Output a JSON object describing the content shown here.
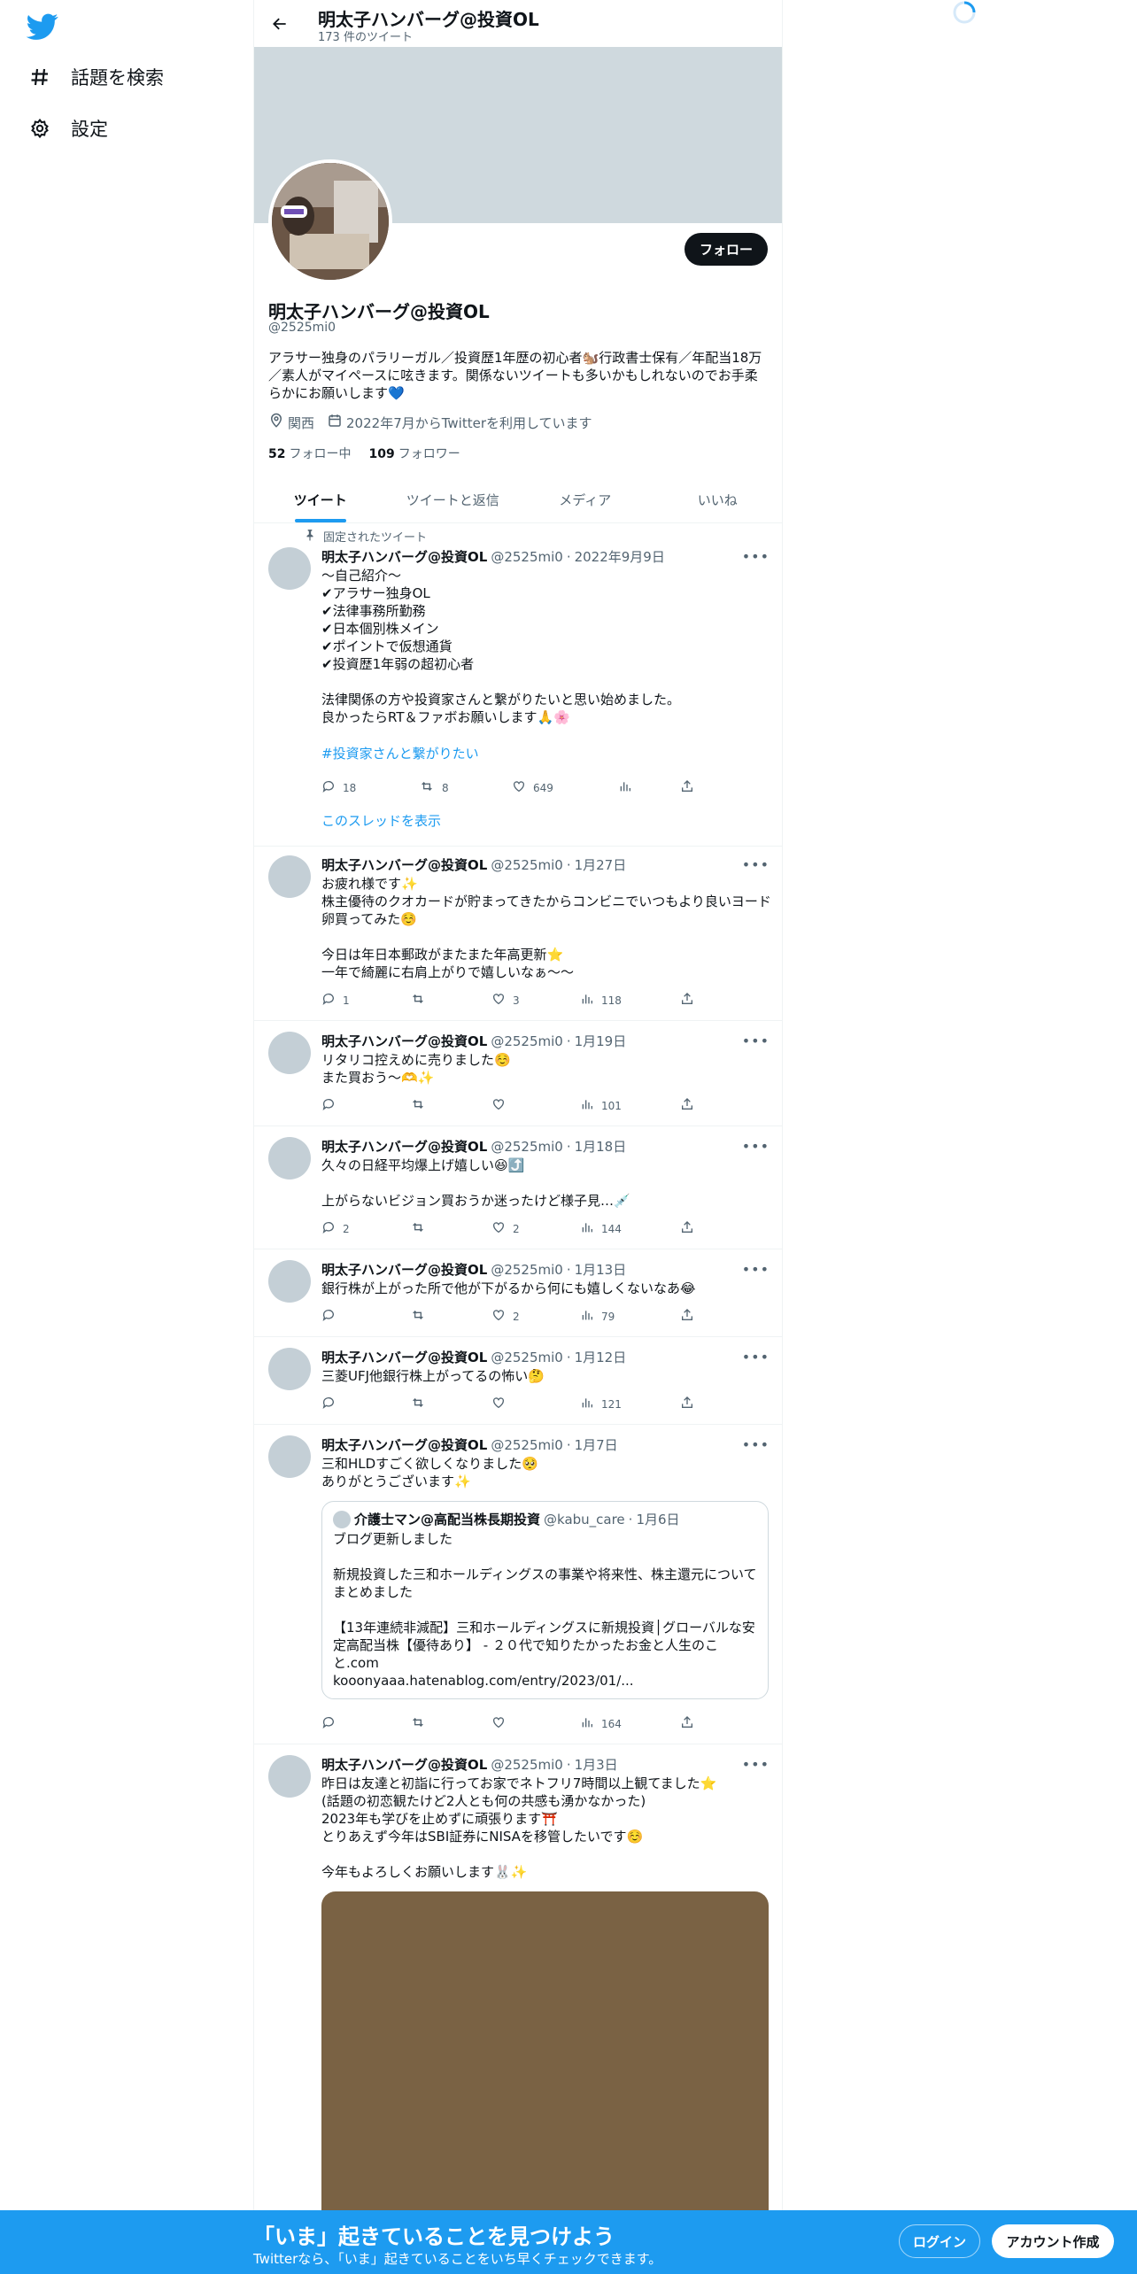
{
  "nav": {
    "items": [
      {
        "label": "話題を検索",
        "icon": "hashtag-icon"
      },
      {
        "label": "設定",
        "icon": "gear-icon"
      }
    ]
  },
  "header": {
    "title": "明太子ハンバーグ@投資OL",
    "subtitle": "173 件のツイート"
  },
  "profile": {
    "follow_label": "フォロー",
    "name": "明太子ハンバーグ@投資OL",
    "handle": "@2525mi0",
    "bio": "アラサー独身のパラリーガル／投資歴1年歴の初心者🐿️行政書士保有／年配当18万／素人がマイペースに呟きます。関係ないツイートも多いかもしれないのでお手柔らかにお願いします💙",
    "location": "関西",
    "joined": "2022年7月からTwitterを利用しています",
    "following_count": "52",
    "following_label": "フォロー中",
    "followers_count": "109",
    "followers_label": "フォロワー"
  },
  "tabs": [
    "ツイート",
    "ツイートと返信",
    "メディア",
    "いいね"
  ],
  "pinned_label": "固定されたツイート",
  "thread_link": "このスレッドを表示",
  "tweets": [
    {
      "name": "明太子ハンバーグ@投資OL",
      "handle": "@2525mi0",
      "date": "2022年9月9日",
      "text": "～自己紹介～\n✔アラサー独身OL\n✔法律事務所勤務\n✔日本個別株メイン\n✔ポイントで仮想通貨\n✔投資歴1年弱の超初心者\n\n法律関係の方や投資家さんと繋がりたいと思い始めました。\n良かったらRT＆ファボお願いします🙏🌸",
      "hashtag": "#投資家さんと繋がりたい",
      "replies": "18",
      "retweets": "8",
      "likes": "649",
      "views": ""
    },
    {
      "name": "明太子ハンバーグ@投資OL",
      "handle": "@2525mi0",
      "date": "1月27日",
      "text": "お疲れ様です✨\n株主優待のクオカードが貯まってきたからコンビニでいつもより良いヨード卵買ってみた☺️\n\n今日は年日本郵政がまたまた年高更新⭐\n一年で綺麗に右肩上がりで嬉しいなぁ〜〜",
      "replies": "1",
      "retweets": "",
      "likes": "3",
      "views": "118"
    },
    {
      "name": "明太子ハンバーグ@投資OL",
      "handle": "@2525mi0",
      "date": "1月19日",
      "text": "リタリコ控えめに売りました☺️\nまた買おう〜🫶✨",
      "replies": "",
      "retweets": "",
      "likes": "",
      "views": "101"
    },
    {
      "name": "明太子ハンバーグ@投資OL",
      "handle": "@2525mi0",
      "date": "1月18日",
      "text": "久々の日経平均爆上げ嬉しい😆⤴️\n\n上がらないビジョン買おうか迷ったけど様子見…💉",
      "replies": "2",
      "retweets": "",
      "likes": "2",
      "views": "144"
    },
    {
      "name": "明太子ハンバーグ@投資OL",
      "handle": "@2525mi0",
      "date": "1月13日",
      "text": "銀行株が上がった所で他が下がるから何にも嬉しくないなあ😂",
      "replies": "",
      "retweets": "",
      "likes": "2",
      "views": "79"
    },
    {
      "name": "明太子ハンバーグ@投資OL",
      "handle": "@2525mi0",
      "date": "1月12日",
      "text": "三菱UFJ他銀行株上がってるの怖い🤔",
      "replies": "",
      "retweets": "",
      "likes": "",
      "views": "121"
    },
    {
      "name": "明太子ハンバーグ@投資OL",
      "handle": "@2525mi0",
      "date": "1月7日",
      "text": "三和HLDすごく欲しくなりました🥺\nありがとうございます✨",
      "replies": "",
      "retweets": "",
      "likes": "",
      "views": "164",
      "quote": {
        "name": "介護士マン@高配当株長期投資",
        "handle": "@kabu_care",
        "date": "1月6日",
        "text": "ブログ更新しました\n\n新規投資した三和ホールディングスの事業や将来性、株主還元についてまとめました\n\n【13年連続非減配】三和ホールディングスに新規投資│グローバルな安定高配当株【優待あり】 - ２０代で知りたかったお金と人生のこと.com\nkooonyaaa.hatenablog.com/entry/2023/01/..."
      }
    },
    {
      "name": "明太子ハンバーグ@投資OL",
      "handle": "@2525mi0",
      "date": "1月3日",
      "text": "昨日は友達と初詣に行ってお家でネトフリ7時間以上観てました⭐\n(話題の初恋観たけど2人とも何の共感も湧かなかった)\n2023年も学びを止めずに頑張ります⛩️\nとりあえず今年はSBI証券にNISAを移管したいです☺️\n\n今年もよろしくお願いします🐰✨",
      "replies": "",
      "retweets": "",
      "likes": "",
      "views": ""
    }
  ],
  "bottom_bar": {
    "title": "「いま」起きていることを見つけよう",
    "subtitle": "Twitterなら、「いま」起きていることをいち早くチェックできます。",
    "login": "ログイン",
    "signup": "アカウント作成"
  },
  "colors": {
    "accent": "#1d9bf0",
    "banner": "#cfd9de",
    "text": "#0f1419",
    "muted": "#536471"
  }
}
